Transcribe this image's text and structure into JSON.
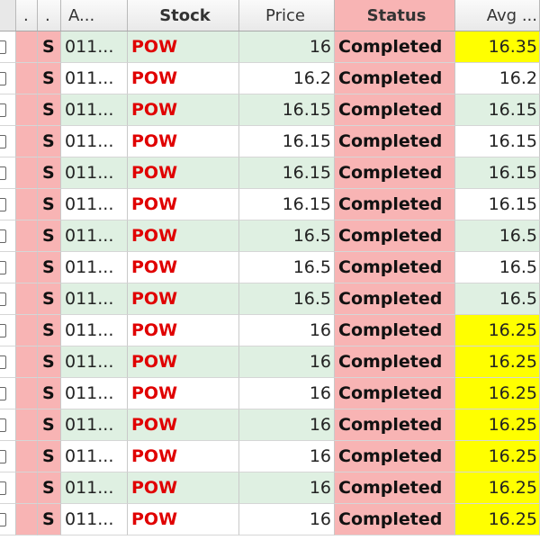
{
  "headers": {
    "col0": "",
    "col1": ".",
    "col2": ".",
    "account": "A...",
    "stock": "Stock",
    "price": "Price",
    "status": "Status",
    "avg": "Avg ..."
  },
  "colors": {
    "pink": "#f8b4b4",
    "green": "#dff0e2",
    "white": "#ffffff",
    "yellow": "#ffff00",
    "stock_red": "#e00000"
  },
  "rows": [
    {
      "side": "S",
      "account": "011...",
      "stock": "POW",
      "price": "16",
      "status": "Completed",
      "avg": "16.35",
      "shade": "green",
      "avg_shade": "yellow"
    },
    {
      "side": "S",
      "account": "011...",
      "stock": "POW",
      "price": "16.2",
      "status": "Completed",
      "avg": "16.2",
      "shade": "white",
      "avg_shade": "white"
    },
    {
      "side": "S",
      "account": "011...",
      "stock": "POW",
      "price": "16.15",
      "status": "Completed",
      "avg": "16.15",
      "shade": "green",
      "avg_shade": "green"
    },
    {
      "side": "S",
      "account": "011...",
      "stock": "POW",
      "price": "16.15",
      "status": "Completed",
      "avg": "16.15",
      "shade": "white",
      "avg_shade": "white"
    },
    {
      "side": "S",
      "account": "011...",
      "stock": "POW",
      "price": "16.15",
      "status": "Completed",
      "avg": "16.15",
      "shade": "green",
      "avg_shade": "green"
    },
    {
      "side": "S",
      "account": "011...",
      "stock": "POW",
      "price": "16.15",
      "status": "Completed",
      "avg": "16.15",
      "shade": "white",
      "avg_shade": "white"
    },
    {
      "side": "S",
      "account": "011...",
      "stock": "POW",
      "price": "16.5",
      "status": "Completed",
      "avg": "16.5",
      "shade": "green",
      "avg_shade": "green"
    },
    {
      "side": "S",
      "account": "011...",
      "stock": "POW",
      "price": "16.5",
      "status": "Completed",
      "avg": "16.5",
      "shade": "white",
      "avg_shade": "white"
    },
    {
      "side": "S",
      "account": "011...",
      "stock": "POW",
      "price": "16.5",
      "status": "Completed",
      "avg": "16.5",
      "shade": "green",
      "avg_shade": "green"
    },
    {
      "side": "S",
      "account": "011...",
      "stock": "POW",
      "price": "16",
      "status": "Completed",
      "avg": "16.25",
      "shade": "white",
      "avg_shade": "yellow"
    },
    {
      "side": "S",
      "account": "011...",
      "stock": "POW",
      "price": "16",
      "status": "Completed",
      "avg": "16.25",
      "shade": "green",
      "avg_shade": "yellow"
    },
    {
      "side": "S",
      "account": "011...",
      "stock": "POW",
      "price": "16",
      "status": "Completed",
      "avg": "16.25",
      "shade": "white",
      "avg_shade": "yellow"
    },
    {
      "side": "S",
      "account": "011...",
      "stock": "POW",
      "price": "16",
      "status": "Completed",
      "avg": "16.25",
      "shade": "green",
      "avg_shade": "yellow"
    },
    {
      "side": "S",
      "account": "011...",
      "stock": "POW",
      "price": "16",
      "status": "Completed",
      "avg": "16.25",
      "shade": "white",
      "avg_shade": "yellow"
    },
    {
      "side": "S",
      "account": "011...",
      "stock": "POW",
      "price": "16",
      "status": "Completed",
      "avg": "16.25",
      "shade": "green",
      "avg_shade": "yellow"
    },
    {
      "side": "S",
      "account": "011...",
      "stock": "POW",
      "price": "16",
      "status": "Completed",
      "avg": "16.25",
      "shade": "white",
      "avg_shade": "yellow"
    }
  ]
}
